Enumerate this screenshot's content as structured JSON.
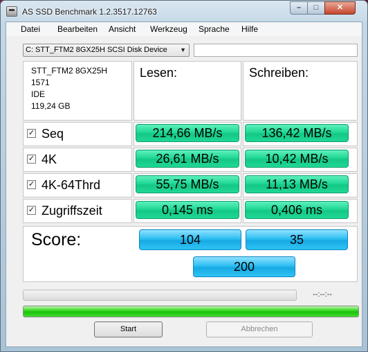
{
  "window": {
    "title": "AS SSD Benchmark 1.2.3517.12763"
  },
  "menu": [
    "Datei",
    "Bearbeiten",
    "Ansicht",
    "Werkzeug",
    "Sprache",
    "Hilfe"
  ],
  "drive": {
    "selected": "C: STT_FTM2 8GX25H SCSI Disk Device",
    "info_lines": [
      "STT_FTM2 8GX25H",
      "1571",
      "IDE",
      "119,24 GB"
    ]
  },
  "columns": {
    "read": "Lesen:",
    "write": "Schreiben:"
  },
  "rows": [
    {
      "label": "Seq",
      "checked": true,
      "read": "214,66 MB/s",
      "write": "136,42 MB/s"
    },
    {
      "label": "4K",
      "checked": true,
      "read": "26,61 MB/s",
      "write": "10,42 MB/s"
    },
    {
      "label": "4K-64Thrd",
      "checked": true,
      "read": "55,75 MB/s",
      "write": "11,13 MB/s"
    },
    {
      "label": "Zugriffszeit",
      "checked": true,
      "read": "0,145 ms",
      "write": "0,406 ms"
    }
  ],
  "score": {
    "label": "Score:",
    "read": "104",
    "write": "35",
    "total": "200"
  },
  "status": {
    "time": "--:--:--",
    "progress_fraction": 1.0
  },
  "buttons": {
    "start": "Start",
    "cancel": "Abbrechen"
  },
  "colors": {
    "value_green": "#21d895",
    "score_blue": "#2ebff2",
    "progress_green": "#31d41c"
  }
}
